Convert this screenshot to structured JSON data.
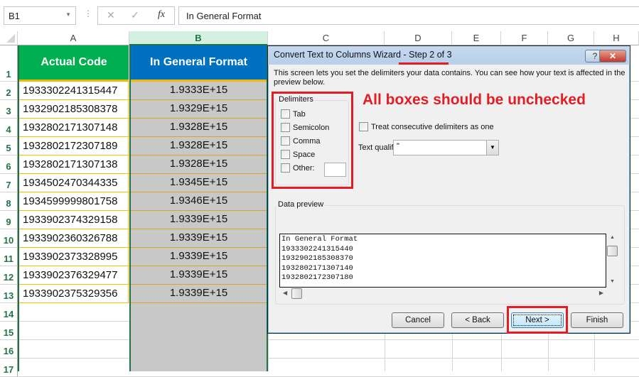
{
  "formula_bar": {
    "name_box": "B1",
    "cancel_icon": "✕",
    "enter_icon": "✓",
    "fx_label": "fx",
    "formula": "In General Format"
  },
  "columns": [
    "A",
    "B",
    "C",
    "D",
    "E",
    "F",
    "G",
    "H"
  ],
  "rows": [
    "1",
    "2",
    "3",
    "4",
    "5",
    "6",
    "7",
    "8",
    "9",
    "10",
    "11",
    "12",
    "13",
    "14",
    "15",
    "16",
    "17"
  ],
  "sheet": {
    "header_a": "Actual Code",
    "header_b": "In General Format",
    "header_a_color": "#00b050",
    "header_b_color": "#0070c0",
    "col_a": [
      "1933302241315447",
      "1932902185308378",
      "1932802171307148",
      "1932802172307189",
      "1932802171307138",
      "1934502470344335",
      "1934599999801758",
      "1933902374329158",
      "1933902360326788",
      "1933902373328995",
      "1933902376329477",
      "1933902375329356"
    ],
    "col_b": [
      "1.9333E+15",
      "1.9329E+15",
      "1.9328E+15",
      "1.9328E+15",
      "1.9328E+15",
      "1.9345E+15",
      "1.9346E+15",
      "1.9339E+15",
      "1.9339E+15",
      "1.9339E+15",
      "1.9339E+15",
      "1.9339E+15"
    ]
  },
  "dialog": {
    "title_prefix": "Convert Text to Columns Wizard - ",
    "title_step": "Step 2 of 3",
    "help_label": "?",
    "close_label": "✕",
    "description": "This screen lets you set the delimiters your data contains.  You can see how your text is affected in the preview below.",
    "delimiters_label": "Delimiters",
    "delimiters": [
      {
        "label": "Tab",
        "checked": false
      },
      {
        "label": "Semicolon",
        "checked": false
      },
      {
        "label": "Comma",
        "checked": false
      },
      {
        "label": "Space",
        "checked": false
      },
      {
        "label": "Other:",
        "checked": false
      }
    ],
    "other_value": "",
    "annotation": "All boxes should be unchecked",
    "consecutive_label": "Treat consecutive delimiters as one",
    "consecutive_checked": false,
    "qualifier_label": "Text qualifier:",
    "qualifier_value": "\"",
    "preview_label": "Data preview",
    "preview_lines": [
      "In General Format",
      "1933302241315440",
      "1932902185308370",
      "1932802171307140",
      "1932802172307180"
    ],
    "buttons": {
      "cancel": "Cancel",
      "back": "< Back",
      "next": "Next >",
      "finish": "Finish"
    },
    "highlight_color": "#e31d24"
  }
}
